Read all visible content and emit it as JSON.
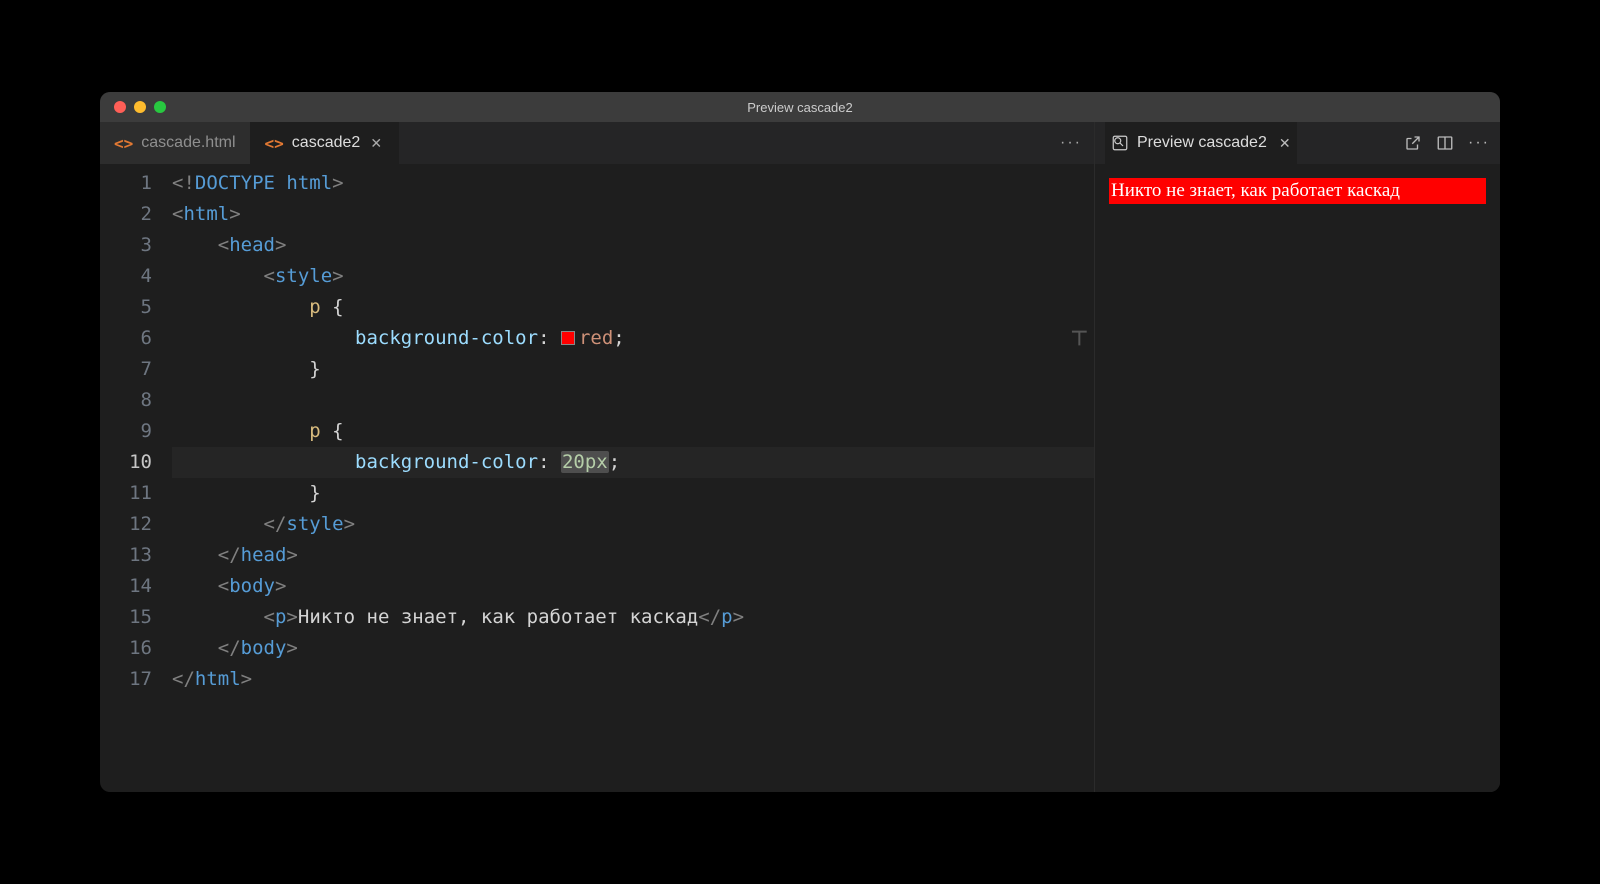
{
  "window": {
    "title": "Preview cascade2"
  },
  "editor": {
    "tabs": [
      {
        "label": "cascade.html",
        "active": false,
        "closeable": false
      },
      {
        "label": "cascade2",
        "active": true,
        "closeable": true
      }
    ],
    "active_line": 10,
    "gutter": [
      "1",
      "2",
      "3",
      "4",
      "5",
      "6",
      "7",
      "8",
      "9",
      "10",
      "11",
      "12",
      "13",
      "14",
      "15",
      "16",
      "17"
    ],
    "code": {
      "l1": {
        "a": "<!",
        "b": "DOCTYPE",
        "c": " html",
        "d": ">"
      },
      "l2": {
        "a": "<",
        "b": "html",
        "c": ">"
      },
      "l3": {
        "a": "<",
        "b": "head",
        "c": ">"
      },
      "l4": {
        "a": "<",
        "b": "style",
        "c": ">"
      },
      "l5": {
        "sel": "p ",
        "brace": "{"
      },
      "l6": {
        "prop": "background-color",
        "colon": ": ",
        "val": "red",
        "semi": ";"
      },
      "l7": {
        "brace": "}"
      },
      "l9": {
        "sel": "p ",
        "brace": "{"
      },
      "l10": {
        "prop": "background-color",
        "colon": ": ",
        "num": "20px",
        "semi": ";"
      },
      "l11": {
        "brace": "}"
      },
      "l12": {
        "a": "</",
        "b": "style",
        "c": ">"
      },
      "l13": {
        "a": "</",
        "b": "head",
        "c": ">"
      },
      "l14": {
        "a": "<",
        "b": "body",
        "c": ">"
      },
      "l15": {
        "a": "<",
        "b": "p",
        "c": ">",
        "text": "Никто не знает, как работает каскад",
        "d": "</",
        "e": "p",
        "f": ">"
      },
      "l16": {
        "a": "</",
        "b": "body",
        "c": ">"
      },
      "l17": {
        "a": "</",
        "b": "html",
        "c": ">"
      }
    }
  },
  "preview": {
    "tab_label": "Preview cascade2",
    "paragraph": "Никто не знает, как работает каскад"
  }
}
